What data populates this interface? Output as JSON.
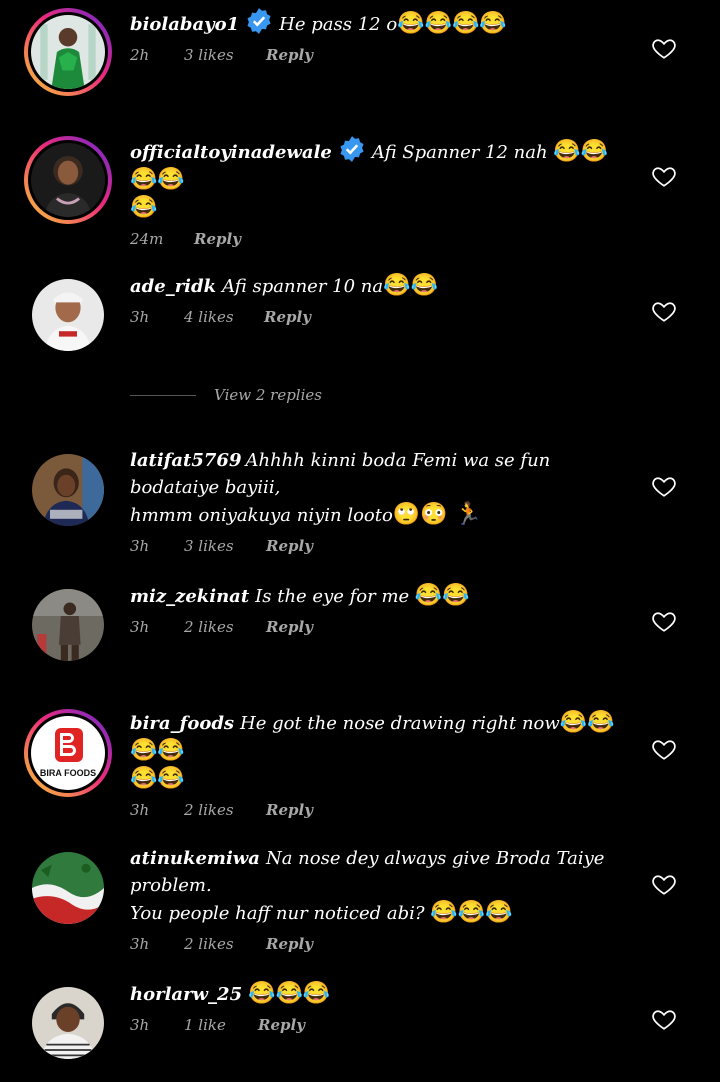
{
  "comments": [
    {
      "username": "biolabayo1",
      "verified": true,
      "text": "He pass 12 o",
      "emoji": "😂😂😂😂",
      "text2": "",
      "time": "2h",
      "likes": "3 likes",
      "reply": "Reply",
      "avatar": "woman-green-dress"
    },
    {
      "username": "officialtoyinadewale",
      "verified": true,
      "text": "Afi Spanner 12 nah",
      "emoji": "😂😂😂😂",
      "text2": "😂",
      "time": "24m",
      "likes": "",
      "reply": "Reply",
      "avatar": "woman-portrait"
    },
    {
      "username": "ade_ridk",
      "verified": false,
      "text": "Afi spanner 10 na",
      "emoji": "😂😂",
      "text2": "",
      "time": "3h",
      "likes": "4 likes",
      "reply": "Reply",
      "avatar": "man-cap"
    },
    {
      "username": "latifat5769",
      "verified": false,
      "text": "Ahhhh kinni boda Femi wa se fun bodataiye bayiii,",
      "emoji": "",
      "text2": "hmmm oniyakuya niyin looto",
      "text2_emoji": "🙄😳 🏃",
      "time": "3h",
      "likes": "3 likes",
      "reply": "Reply",
      "avatar": "woman-smiling"
    },
    {
      "username": "miz_zekinat",
      "verified": false,
      "text": "Is the eye for me",
      "emoji": "😂😂",
      "text2": "",
      "time": "3h",
      "likes": "2 likes",
      "reply": "Reply",
      "avatar": "woman-standing"
    },
    {
      "username": "bira_foods",
      "verified": false,
      "text": "He got the nose drawing right now",
      "emoji": "😂😂😂😂",
      "text2": "😂😂",
      "time": "3h",
      "likes": "2 likes",
      "reply": "Reply",
      "avatar": "bira-foods-logo",
      "logo_text": "BIRA FOODS"
    },
    {
      "username": "atinukemiwa",
      "verified": false,
      "text": "Na nose dey always give Broda Taiye problem.",
      "emoji": "",
      "text2": "You people haff nur noticed abi?",
      "text2_emoji": "😂😂😂",
      "time": "3h",
      "likes": "2 likes",
      "reply": "Reply",
      "avatar": "flag-splash"
    },
    {
      "username": "horlarw_25",
      "verified": false,
      "text": "",
      "emoji": "😂😂😂",
      "text2": "",
      "time": "3h",
      "likes": "1 like",
      "reply": "Reply",
      "avatar": "woman-headwrap"
    }
  ],
  "view_replies": "View 2 replies",
  "colors": {
    "background": "#000000",
    "muted": "#a8a8a8",
    "verified": "#3897f0"
  }
}
